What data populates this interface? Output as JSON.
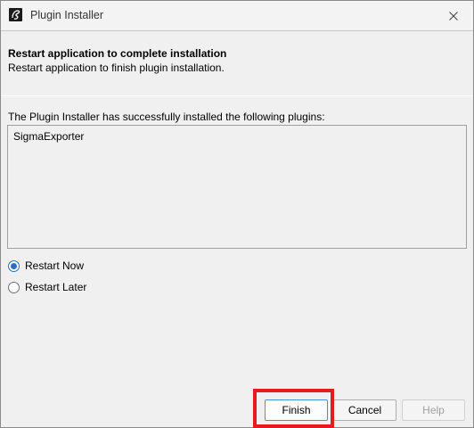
{
  "window": {
    "title": "Plugin Installer",
    "icon": "app-logo-icon",
    "close_icon": "close-icon"
  },
  "header": {
    "title": "Restart application to complete installation",
    "subtitle": "Restart application to finish plugin installation."
  },
  "main": {
    "info_text": "The Plugin Installer has successfully installed the following plugins:",
    "plugins": [
      "SigmaExporter"
    ]
  },
  "options": [
    {
      "label": "Restart Now",
      "checked": true
    },
    {
      "label": "Restart Later",
      "checked": false
    }
  ],
  "buttons": {
    "finish": "Finish",
    "cancel": "Cancel",
    "help": "Help"
  },
  "colors": {
    "highlight": "#e31c23",
    "accent": "#2b6fc2"
  }
}
